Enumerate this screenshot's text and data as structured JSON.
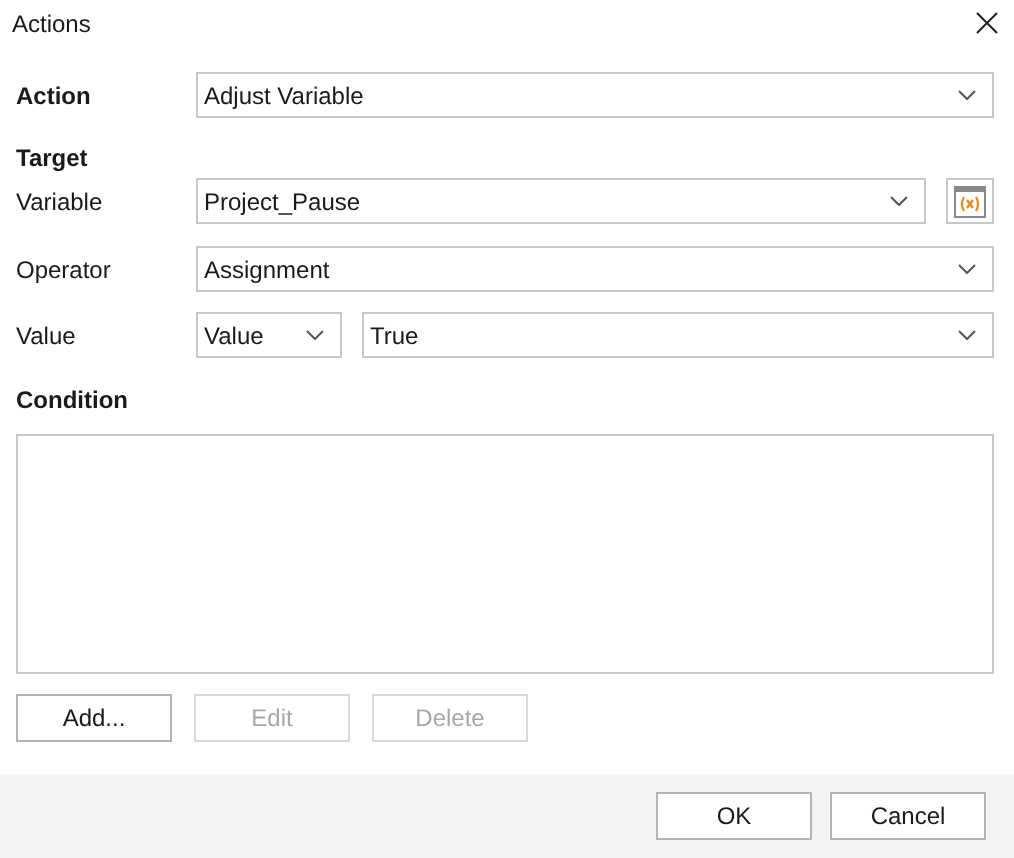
{
  "window": {
    "title": "Actions"
  },
  "action": {
    "label": "Action",
    "value": "Adjust Variable"
  },
  "target": {
    "heading": "Target",
    "variable": {
      "label": "Variable",
      "value": "Project_Pause"
    },
    "operator": {
      "label": "Operator",
      "value": "Assignment"
    },
    "value": {
      "label": "Value",
      "type": "Value",
      "value": "True"
    }
  },
  "condition": {
    "heading": "Condition"
  },
  "condition_buttons": [
    {
      "label": "Add...",
      "disabled": false
    },
    {
      "label": "Edit",
      "disabled": true
    },
    {
      "label": "Delete",
      "disabled": true
    }
  ],
  "footer_buttons": [
    "OK",
    "Cancel"
  ]
}
